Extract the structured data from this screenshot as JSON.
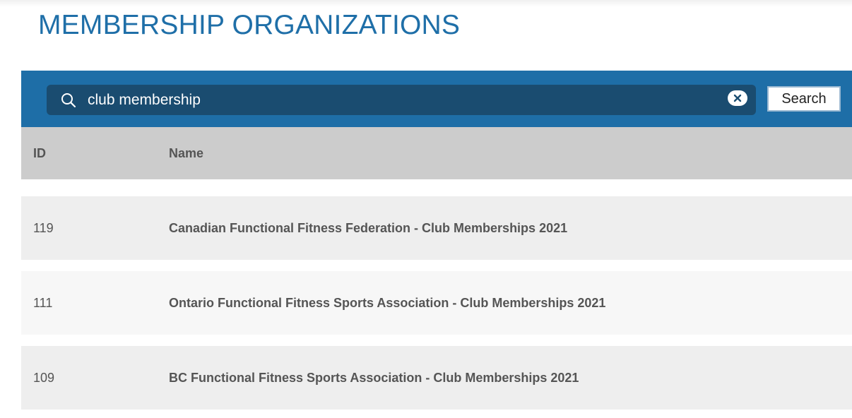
{
  "page": {
    "title": "MEMBERSHIP ORGANIZATIONS"
  },
  "search": {
    "value": "club membership",
    "button_label": "Search",
    "icon": "search-icon",
    "clear_icon": "close-icon"
  },
  "table": {
    "headers": {
      "id": "ID",
      "name": "Name"
    },
    "rows": [
      {
        "id": "119",
        "name": "Canadian Functional Fitness Federation - Club Memberships 2021"
      },
      {
        "id": "111",
        "name": "Ontario Functional Fitness Sports Association - Club Memberships 2021"
      },
      {
        "id": "109",
        "name": "BC Functional Fitness Sports Association - Club Memberships 2021"
      }
    ]
  },
  "colors": {
    "title": "#1f6fa8",
    "search_bar": "#1e6ea7",
    "search_field": "#1a4c70",
    "header_bg": "#cccccc",
    "row_bg": "#eeeeee",
    "row_alt_bg": "#f7f7f7"
  }
}
